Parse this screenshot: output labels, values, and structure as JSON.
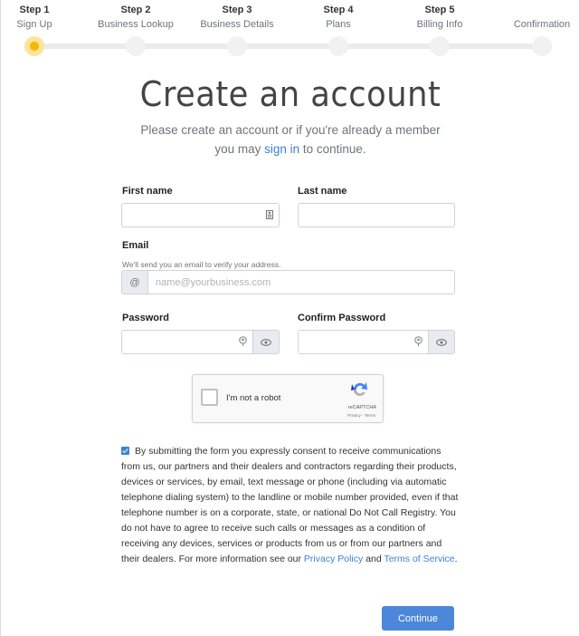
{
  "stepper": {
    "active_index": 0,
    "accent_color": "#f5b800",
    "steps": [
      {
        "number": "Step 1",
        "label": "Sign Up"
      },
      {
        "number": "Step 2",
        "label": "Business Lookup"
      },
      {
        "number": "Step 3",
        "label": "Business Details"
      },
      {
        "number": "Step 4",
        "label": "Plans"
      },
      {
        "number": "Step 5",
        "label": "Billing Info"
      },
      {
        "number": "",
        "label": "Confirmation"
      }
    ]
  },
  "header": {
    "title": "Create an account",
    "subtitle_before": "Please create an account or if you're already a member you may ",
    "signin_link": "sign in",
    "subtitle_after": " to continue."
  },
  "form": {
    "first_name": {
      "label": "First name",
      "value": "",
      "placeholder": "",
      "icon": "contact-card-icon"
    },
    "last_name": {
      "label": "Last name",
      "value": "",
      "placeholder": ""
    },
    "email": {
      "label": "Email",
      "hint": "We'll send you an email to verify your address.",
      "value": "",
      "placeholder": "name@yourbusiness.com",
      "icon": "at-sign-icon"
    },
    "password": {
      "label": "Password",
      "value": "",
      "placeholder": "",
      "icon": "key-icon",
      "toggle_icon": "eye-icon"
    },
    "confirm_password": {
      "label": "Confirm Password",
      "value": "",
      "placeholder": "",
      "icon": "key-icon",
      "toggle_icon": "eye-icon"
    }
  },
  "captcha": {
    "checkbox_label": "I'm not a robot",
    "checked": false,
    "brand": "reCAPTCHA",
    "terms": "Privacy - Terms"
  },
  "consent": {
    "checked": true,
    "text": "By submitting the form you expressly consent to receive communications from us, our partners and their dealers and contractors regarding their products, devices or services, by email, text message or phone (including via automatic telephone dialing system) to the landline or mobile number provided, even if that telephone number is on a corporate, state, or national Do Not Call Registry. You do not have to agree to receive such calls or messages as a condition of receiving any devices, services or products from us or from our partners and their dealers. For more information see our ",
    "privacy_link": "Privacy Policy",
    "and": " and ",
    "terms_link": "Terms of Service",
    "end": "."
  },
  "actions": {
    "continue_label": "Continue",
    "primary_color": "#4d87d9",
    "link_color": "#3b82d6"
  }
}
